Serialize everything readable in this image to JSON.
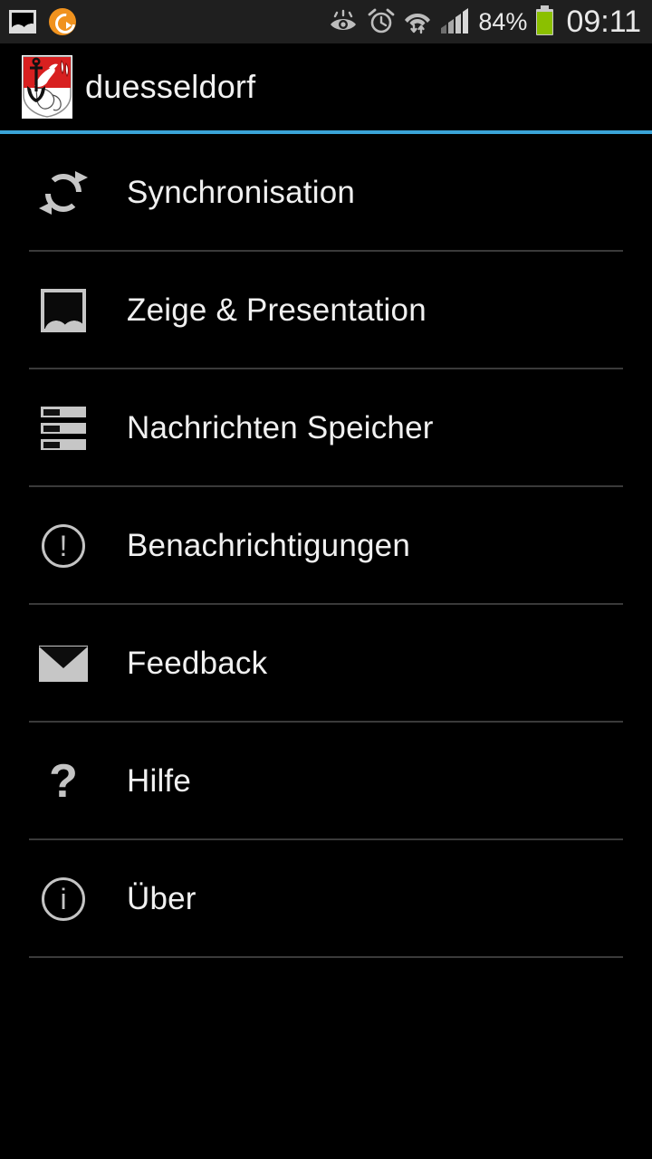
{
  "status_bar": {
    "left_icons": [
      {
        "name": "gallery-icon",
        "label": "gallery"
      },
      {
        "name": "sync-app-icon",
        "label": "app"
      }
    ],
    "right_icons": [
      {
        "name": "smart-stay-eye-icon",
        "label": "smart stay"
      },
      {
        "name": "alarm-clock-icon",
        "label": "alarm"
      },
      {
        "name": "wifi-data-transfer-icon",
        "label": "wifi"
      },
      {
        "name": "signal-bars-icon",
        "label": "signal"
      }
    ],
    "battery_percent": "84%",
    "battery_level": 84,
    "clock": "09:11",
    "background_color": "#1f1f1f",
    "battery_fill_color": "#8bc000"
  },
  "header": {
    "title": "duesseldorf",
    "logo_name": "duesseldorf-coat-of-arms",
    "accent_color": "#3aa4d8",
    "background_color": "#000000"
  },
  "menu": {
    "items": [
      {
        "label": "Synchronisation",
        "icon": "sync-refresh-icon"
      },
      {
        "label": "Zeige & Presentation",
        "icon": "image-photo-icon"
      },
      {
        "label": "Nachrichten Speicher",
        "icon": "message-storage-list-icon"
      },
      {
        "label": "Benachrichtigungen",
        "icon": "alert-exclamation-circle-icon"
      },
      {
        "label": "Feedback",
        "icon": "envelope-mail-icon"
      },
      {
        "label": "Hilfe",
        "icon": "question-mark-icon"
      },
      {
        "label": "Über",
        "icon": "info-circle-icon"
      }
    ],
    "divider_color": "#3a3a3a",
    "text_color": "#f0f0f0",
    "icon_color": "#c6c6c6"
  },
  "glyphs": {
    "exclamation": "!",
    "info": "i",
    "question": "?"
  }
}
